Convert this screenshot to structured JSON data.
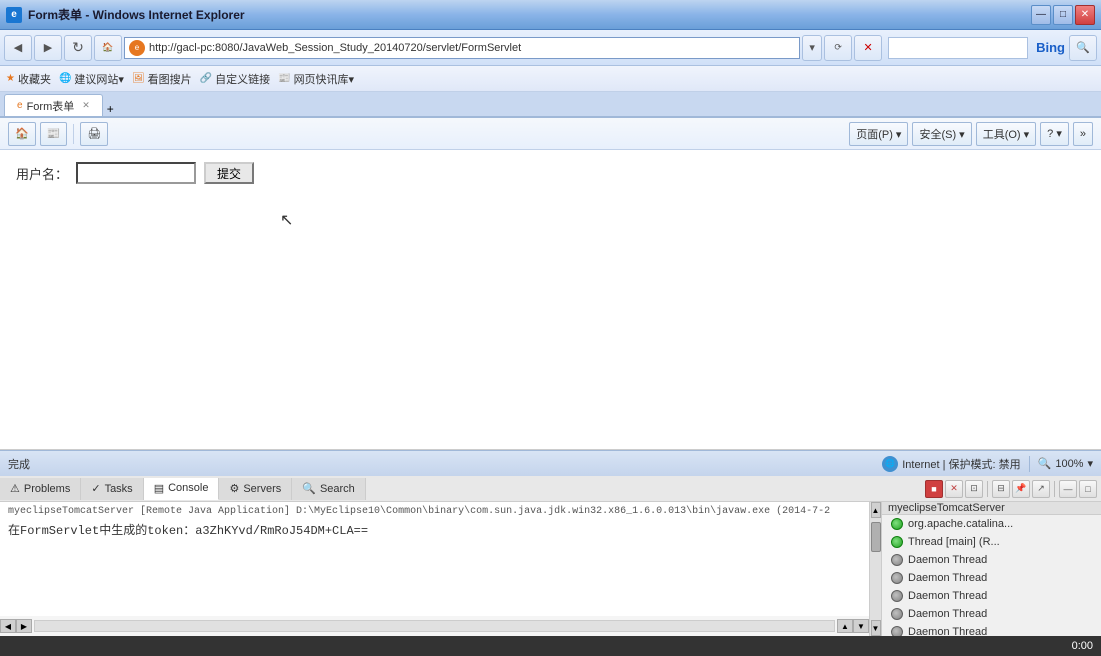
{
  "titleBar": {
    "title": "Form表单 - Windows Internet Explorer",
    "icon": "e",
    "controls": {
      "minimize": "—",
      "maximize": "□",
      "close": "✕"
    }
  },
  "navBar": {
    "back": "◀",
    "forward": "▶",
    "refresh": "↻",
    "address": "http://gacl-pc:8080/JavaWeb_Session_Study_20140720/servlet/FormServlet",
    "search_placeholder": "Bing",
    "bing": "Bing"
  },
  "favBar": {
    "items": [
      {
        "label": "收藏夹"
      },
      {
        "label": "建议网站▾"
      },
      {
        "label": "看图搜片"
      },
      {
        "label": "自定义链接"
      },
      {
        "label": "网页快讯库▾"
      }
    ]
  },
  "tab": {
    "label": "Form表单",
    "icon": "e"
  },
  "toolbar": {
    "home": "🏠",
    "feeds": "📰",
    "print": "🖨",
    "page": "页面(P) ▾",
    "safety": "安全(S) ▾",
    "tools": "工具(O) ▾",
    "help": "? ▾"
  },
  "browserContent": {
    "formLabel": "用户名：",
    "submitBtn": "提交"
  },
  "statusBar": {
    "status": "完成",
    "internet": "Internet | 保护模式: 禁用",
    "zoom": "100%"
  },
  "ideTabs": [
    {
      "label": "Problems",
      "icon": "!"
    },
    {
      "label": "Tasks",
      "icon": "✓"
    },
    {
      "label": "Console",
      "icon": "▤",
      "active": true
    },
    {
      "label": "Servers",
      "icon": "≡"
    },
    {
      "label": "Search",
      "icon": "🔍"
    }
  ],
  "console": {
    "header": "myeclipseTomcatServer [Remote Java Application] D:\\MyEclipse10\\Common\\binary\\com.sun.java.jdk.win32.x86_1.6.0.013\\bin\\javaw.exe (2014-7-2",
    "output": "在FormServlet中生成的token：a3ZhKYvd/RmRoJ54DM+CLA=="
  },
  "rightPanel": {
    "header": "myeclipseTomcatServer",
    "threads": [
      {
        "label": "org.apache.catalina...",
        "type": "green"
      },
      {
        "label": "Thread [main] (R...",
        "type": "green"
      },
      {
        "label": "Daemon Thread",
        "type": "gray"
      },
      {
        "label": "Daemon Thread",
        "type": "gray"
      },
      {
        "label": "Daemon Thread",
        "type": "gray"
      },
      {
        "label": "Daemon Thread",
        "type": "gray"
      },
      {
        "label": "Daemon Thread",
        "type": "gray"
      }
    ]
  },
  "bottomStrip": {
    "time": "0:00"
  }
}
